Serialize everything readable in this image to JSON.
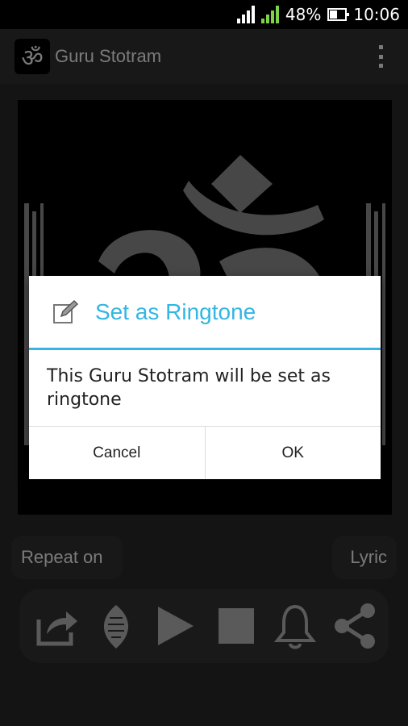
{
  "status": {
    "battery": "48%",
    "time": "10:06"
  },
  "app": {
    "title": "Guru Stotram",
    "logo_glyph": "ॐ"
  },
  "player": {
    "repeat_label": "Repeat on",
    "lyric_label": "Lyric"
  },
  "dialog": {
    "title": "Set as Ringtone",
    "message": "This Guru Stotram will be set as ringtone",
    "cancel_label": "Cancel",
    "ok_label": "OK"
  },
  "colors": {
    "accent": "#33b5e5",
    "icon_gray": "#8a8a8a",
    "artwork_gray": "#6e6e6e"
  },
  "icons": [
    "share-out-icon",
    "conch-icon",
    "play-icon",
    "stop-icon",
    "bell-icon",
    "share-icon"
  ]
}
